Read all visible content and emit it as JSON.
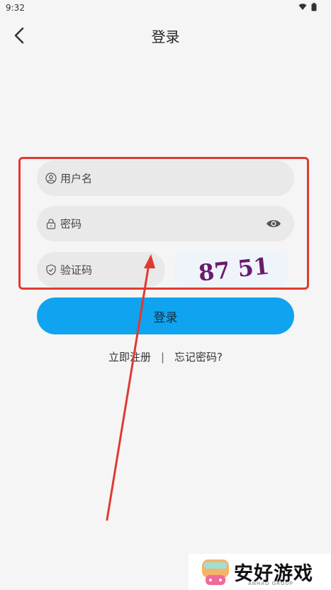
{
  "status": {
    "time": "9:32"
  },
  "header": {
    "title": "登录"
  },
  "form": {
    "username_placeholder": "用户名",
    "password_placeholder": "密码",
    "captcha_placeholder": "验证码",
    "captcha_text": "87 51"
  },
  "actions": {
    "login_label": "登录",
    "register_label": "立即注册",
    "separator": "|",
    "forgot_label": "忘记密码?"
  },
  "watermark": {
    "brand": "安好游戏",
    "sub": "ANHAO GROUP"
  },
  "colors": {
    "accent": "#10a3f0",
    "highlight": "#e03a30"
  }
}
